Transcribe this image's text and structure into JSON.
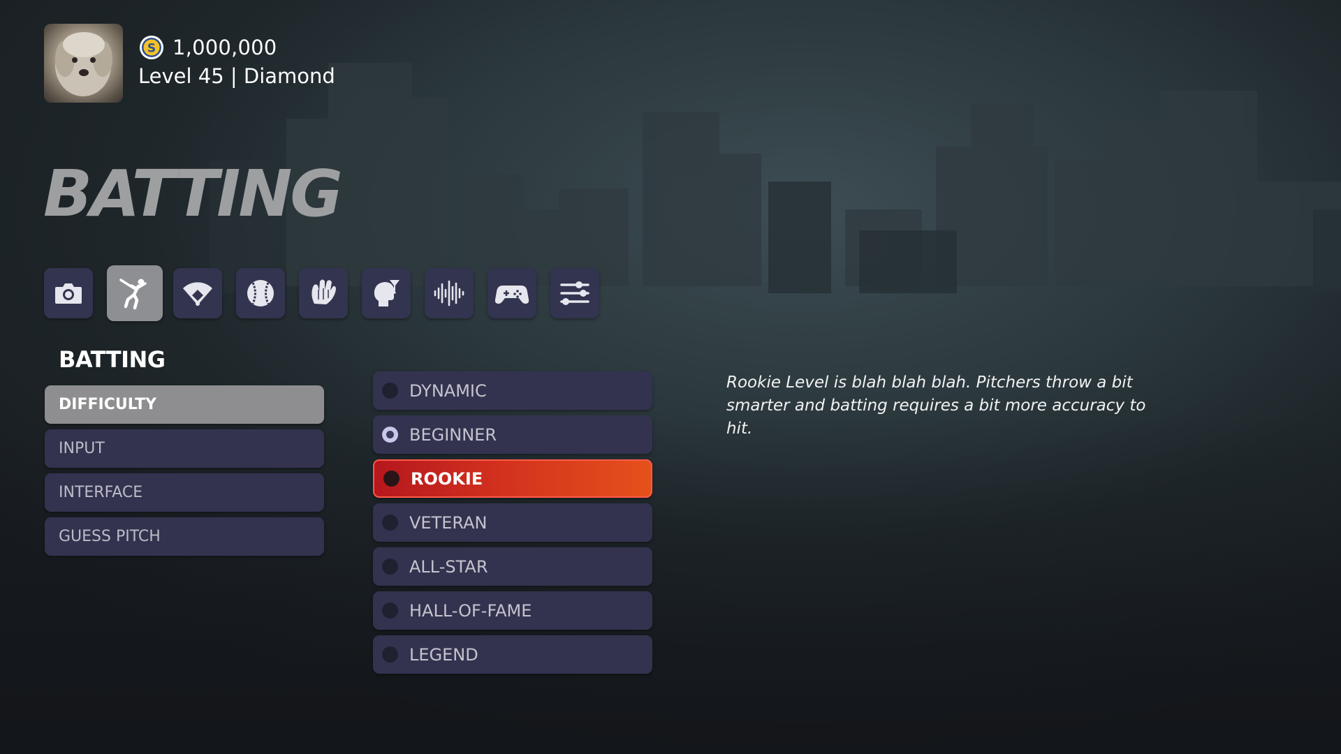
{
  "profile": {
    "avatar_icon": "dog-avatar",
    "currency_icon": "s-coin-icon",
    "currency": "1,000,000",
    "level_text": "Level 45 | Diamond"
  },
  "page": {
    "title": "BATTING"
  },
  "tabs": [
    {
      "name": "camera",
      "icon": "camera-icon",
      "active": false
    },
    {
      "name": "batting",
      "icon": "batter-swing-icon",
      "active": true
    },
    {
      "name": "field",
      "icon": "baseball-diamond-icon",
      "active": false
    },
    {
      "name": "pitching",
      "icon": "baseball-icon",
      "active": false
    },
    {
      "name": "fielding",
      "icon": "glove-icon",
      "active": false
    },
    {
      "name": "strategy",
      "icon": "head-thought-icon",
      "active": false
    },
    {
      "name": "audio",
      "icon": "audio-waveform-icon",
      "active": false
    },
    {
      "name": "controls",
      "icon": "gamepad-icon",
      "active": false
    },
    {
      "name": "settings",
      "icon": "sliders-icon",
      "active": false
    }
  ],
  "section": {
    "label": "BATTING",
    "items": [
      {
        "label": "DIFFICULTY",
        "active": true
      },
      {
        "label": "INPUT",
        "active": false
      },
      {
        "label": "INTERFACE",
        "active": false
      },
      {
        "label": "GUESS PITCH",
        "active": false
      }
    ]
  },
  "difficulty": {
    "options": [
      {
        "label": "DYNAMIC",
        "state": "normal"
      },
      {
        "label": "BEGINNER",
        "state": "selected"
      },
      {
        "label": "ROOKIE",
        "state": "highlighted"
      },
      {
        "label": "VETERAN",
        "state": "normal"
      },
      {
        "label": "ALL-STAR",
        "state": "normal"
      },
      {
        "label": "HALL-OF-FAME",
        "state": "normal"
      },
      {
        "label": "LEGEND",
        "state": "normal"
      }
    ]
  },
  "description": "Rookie Level is blah blah blah. Pitchers throw a bit smarter and batting requires a bit more accuracy to hit.",
  "colors": {
    "panel": "#33334f",
    "active_gray": "#8e8e90",
    "highlight_start": "#b5171e",
    "highlight_end": "#e5511b"
  }
}
